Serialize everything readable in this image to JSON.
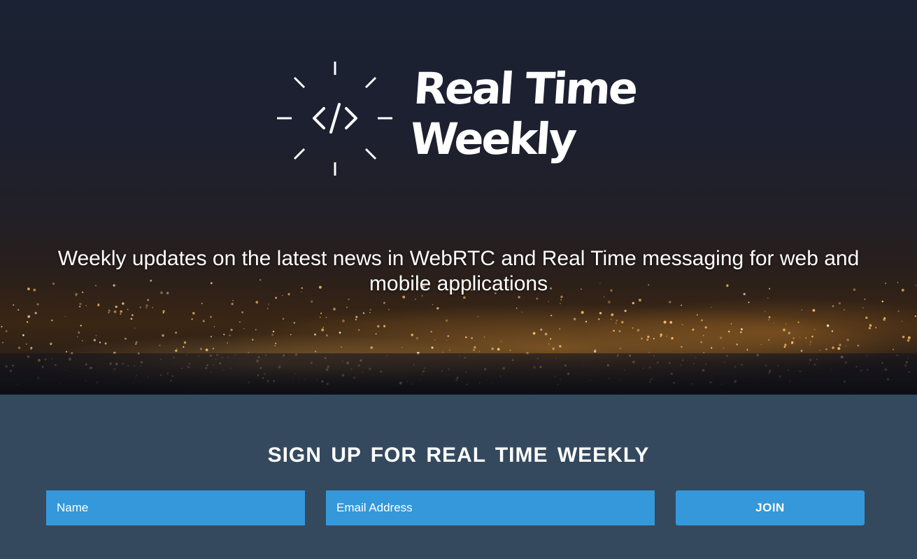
{
  "hero": {
    "logo": {
      "icon": "code-brackets-icon",
      "line1": "Real Time",
      "line2": "Weekly"
    },
    "tagline": "Weekly updates on the latest news in WebRTC and Real Time messaging for web and mobile applications"
  },
  "signup": {
    "title": "SIGN UP FOR REAL TIME WEEKLY",
    "name_placeholder": "Name",
    "email_placeholder": "Email Address",
    "join_label": "JOIN"
  },
  "colors": {
    "section_bg": "#34495e",
    "accent": "#3498db",
    "text": "#ffffff"
  }
}
